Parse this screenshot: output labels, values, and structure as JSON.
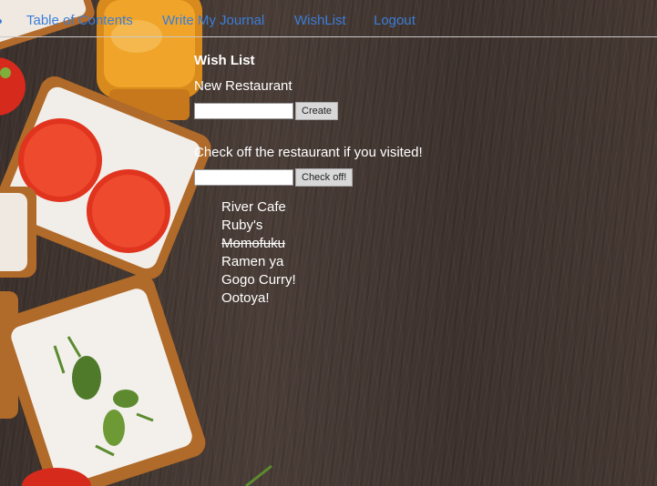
{
  "nav": {
    "items": [
      {
        "label": "Table of Contents"
      },
      {
        "label": "Write My Journal"
      },
      {
        "label": "WishList"
      },
      {
        "label": "Logout"
      }
    ]
  },
  "wishlist": {
    "title": "Wish List",
    "new_restaurant_label": "New Restaurant",
    "create_button": "Create",
    "check_off_label": "Check off the restaurant if you visited!",
    "check_off_button": "Check off!",
    "restaurants": [
      {
        "name": "River Cafe",
        "visited": false
      },
      {
        "name": "Ruby's",
        "visited": false
      },
      {
        "name": "Momofuku",
        "visited": true
      },
      {
        "name": "Ramen ya",
        "visited": false
      },
      {
        "name": "Gogo Curry!",
        "visited": false
      },
      {
        "name": "Ootoya!",
        "visited": false
      }
    ]
  },
  "colors": {
    "link": "#3b7dd8",
    "text": "#ffffff",
    "background": "#3a2e29"
  }
}
